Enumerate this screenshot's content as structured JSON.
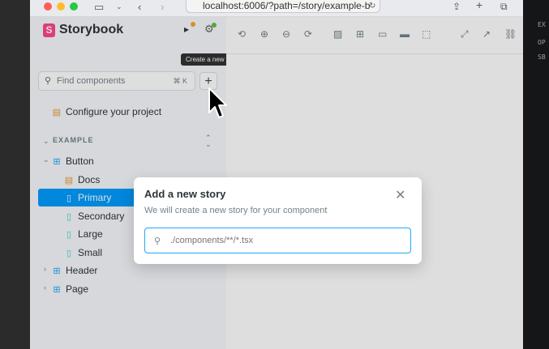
{
  "browser": {
    "url": "localhost:6006/?path=/story/example-b"
  },
  "sidebar": {
    "brand": "Storybook",
    "brand_logo": "S",
    "tooltip": "Create a new story",
    "search_placeholder": "Find components",
    "search_shortcut": "⌘ K",
    "configure_label": "Configure your project",
    "group_label": "EXAMPLE",
    "tree": {
      "button": "Button",
      "docs": "Docs",
      "primary": "Primary",
      "secondary": "Secondary",
      "large": "Large",
      "small": "Small",
      "header": "Header",
      "page": "Page"
    }
  },
  "modal": {
    "title": "Add a new story",
    "description": "We will create a new story for your component",
    "input_placeholder": "./components/**/*.tsx"
  },
  "editor_fragments": [
    "EX",
    "OP",
    "SB"
  ],
  "colors": {
    "accent": "#029cfd",
    "brand": "#ff4785",
    "input_border": "#1ea7fd"
  }
}
